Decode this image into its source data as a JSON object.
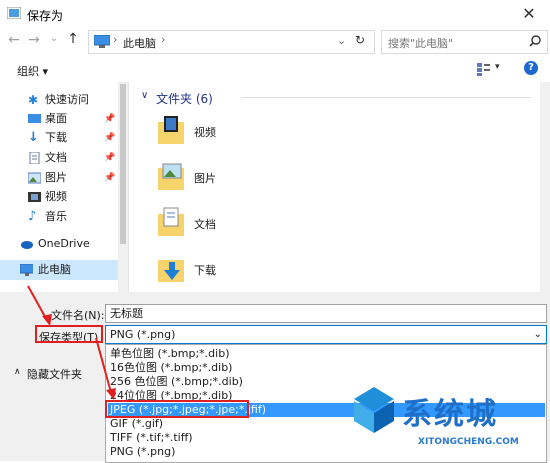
{
  "window": {
    "title": "保存为",
    "close_glyph": "✕"
  },
  "address": {
    "path": "此电脑",
    "search_placeholder": "搜索\"此电脑\""
  },
  "toolbar": {
    "organize_label": "组织 ▾",
    "help_glyph": "?"
  },
  "sidebar": {
    "items": [
      {
        "label": "快速访问",
        "icon": "star-icon"
      },
      {
        "label": "桌面",
        "icon": "desktop-icon",
        "pinned": true
      },
      {
        "label": "下载",
        "icon": "download-icon",
        "pinned": true
      },
      {
        "label": "文档",
        "icon": "document-icon",
        "pinned": true
      },
      {
        "label": "图片",
        "icon": "picture-icon",
        "pinned": true
      },
      {
        "label": "视频",
        "icon": "video-icon"
      },
      {
        "label": "音乐",
        "icon": "music-icon"
      },
      {
        "label": "OneDrive",
        "icon": "cloud-icon"
      },
      {
        "label": "此电脑",
        "icon": "computer-icon",
        "selected": true
      }
    ]
  },
  "main": {
    "group_header": "文件夹 (6)",
    "folders": [
      {
        "label": "视频",
        "icon": "video-folder-icon"
      },
      {
        "label": "图片",
        "icon": "picture-folder-icon"
      },
      {
        "label": "文档",
        "icon": "document-folder-icon"
      },
      {
        "label": "下载",
        "icon": "download-folder-icon"
      }
    ]
  },
  "form": {
    "filename_label": "文件名(N):",
    "filename_value": "无标题",
    "filetype_label": "保存类型(T)",
    "filetype_value": "PNG (*.png)",
    "hide_folders_label": "隐藏文件夹",
    "options": [
      "单色位图 (*.bmp;*.dib)",
      "16色位图 (*.bmp;*.dib)",
      "256 色位图 (*.bmp;*.dib)",
      "24位位图 (*.bmp;*.dib)",
      "JPEG (*.jpg;*.jpeg;*.jpe;*.jfif)",
      "GIF (*.gif)",
      "TIFF (*.tif;*.tiff)",
      "PNG (*.png)"
    ],
    "highlighted_index": 4
  },
  "watermark": {
    "text": "系统城",
    "url": "XITONGCHENG.COM"
  },
  "colors": {
    "accent": "#0078d7",
    "highlight": "#3399ff",
    "annotation_red": "#e02020",
    "header_blue": "#1e3287"
  }
}
